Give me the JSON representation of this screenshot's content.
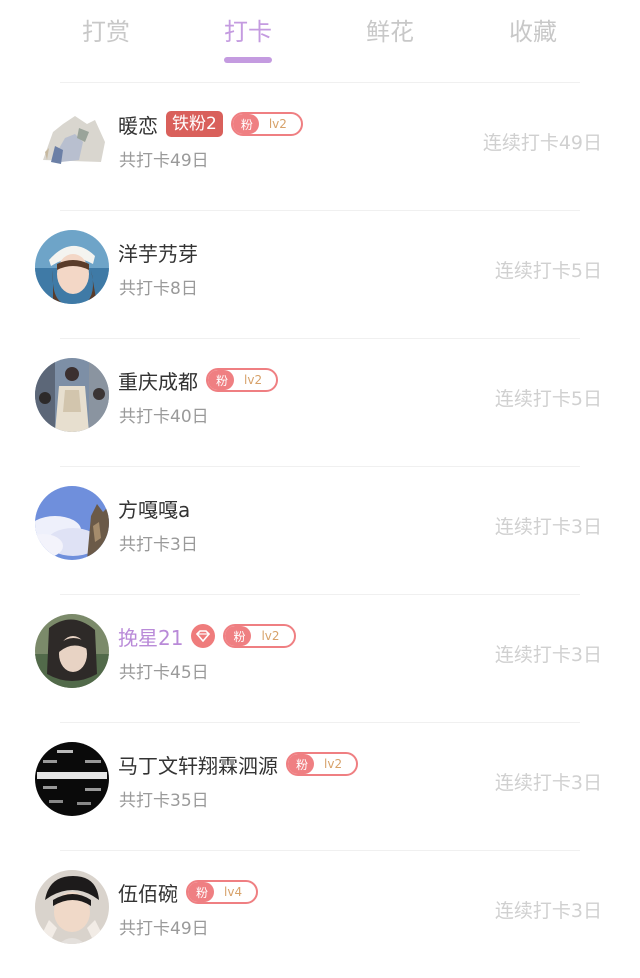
{
  "tabs": [
    {
      "label": "打赏"
    },
    {
      "label": "打卡"
    },
    {
      "label": "鲜花"
    },
    {
      "label": "收藏"
    }
  ],
  "active_tab": "打卡",
  "colors": {
    "accent": "#c49be0",
    "iron_badge": "#d9605b",
    "fan_badge": "#ef7f82",
    "muted_text": "#9a9a9a",
    "streak_text": "#d0d0d0"
  },
  "rows": [
    {
      "name": "暖恋",
      "iron_badge": "铁粉2",
      "fan_label": "粉",
      "fan_level": "lv2",
      "total": "共打卡49日",
      "streak": "连续打卡49日"
    },
    {
      "name": "洋芋艿芽",
      "total": "共打卡8日",
      "streak": "连续打卡5日"
    },
    {
      "name": "重庆成都",
      "fan_label": "粉",
      "fan_level": "lv2",
      "total": "共打卡40日",
      "streak": "连续打卡5日"
    },
    {
      "name": "方嘎嘎a",
      "total": "共打卡3日",
      "streak": "连续打卡3日"
    },
    {
      "name": "挽星21",
      "vip_icon": "diamond-icon",
      "fan_label": "粉",
      "fan_level": "lv2",
      "total": "共打卡45日",
      "streak": "连续打卡3日"
    },
    {
      "name": "马丁文轩翔霖泗源",
      "fan_label": "粉",
      "fan_level": "lv2",
      "total": "共打卡35日",
      "streak": "连续打卡3日"
    },
    {
      "name": "伍佰碗",
      "fan_label": "粉",
      "fan_level": "lv4",
      "total": "共打卡49日",
      "streak": "连续打卡3日"
    }
  ]
}
